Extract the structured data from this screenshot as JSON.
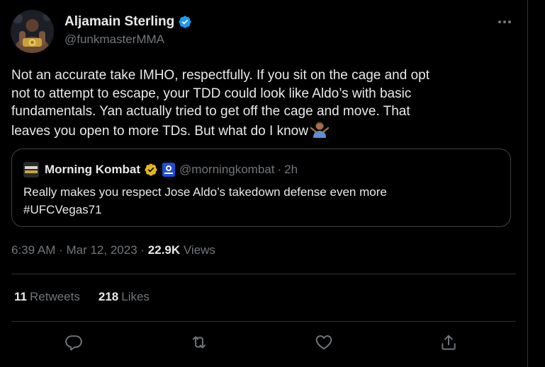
{
  "tweet": {
    "author": {
      "name": "Aljamain Sterling",
      "handle": "@funkmasterMMA",
      "verified": true,
      "avatar_icon": "fighter-with-belt-avatar"
    },
    "text_lines": [
      "Not an accurate take IMHO, respectfully. If you sit on the cage and opt",
      "not to attempt to escape, your TDD could look like Aldo’s with basic",
      "fundamentals. Yan actually tried to get off the cage and move. That",
      "leaves you open to more TDs. But what do I know"
    ],
    "trailing_emoji": "person-shrugging-emoji",
    "quote": {
      "name": "Morning Kombat",
      "verified_badge": "gold-verified-icon",
      "affiliate_badge": "news-affiliate-icon",
      "handle": "@morningkombat",
      "separator": "·",
      "time": "2h",
      "text_lines": [
        "Really makes you respect Jose Aldo’s takedown defense even more",
        "#UFCVegas71"
      ]
    },
    "meta": {
      "timestamp": "6:39 AM · Mar 12, 2023 ·",
      "views_count": "22.9K",
      "views_label": "Views"
    },
    "stats": {
      "retweets_count": "11",
      "retweets_label": "Retweets",
      "likes_count": "218",
      "likes_label": "Likes"
    },
    "actions": [
      "reply-icon",
      "retweet-icon",
      "like-icon",
      "share-icon"
    ]
  },
  "colors": {
    "background": "#000000",
    "text_primary": "#e7e9ea",
    "text_secondary": "#71767b",
    "border": "#2f3336",
    "verified_blue": "#1d9bf0",
    "verified_gold": "#e2b719"
  }
}
